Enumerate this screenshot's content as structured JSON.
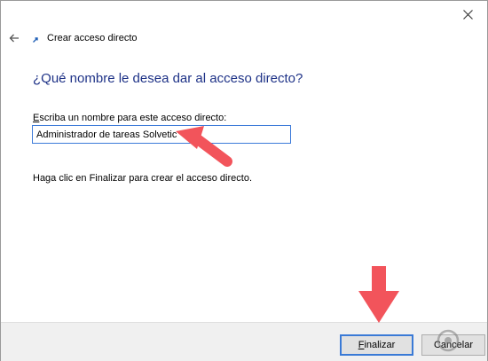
{
  "wizard": {
    "title": "Crear acceso directo",
    "heading": "¿Qué nombre le desea dar al acceso directo?",
    "field_label": "Escriba un nombre para este acceso directo:",
    "name_value": "Administrador de tareas Solvetic",
    "hint": "Haga clic en Finalizar para crear el acceso directo."
  },
  "buttons": {
    "finish_label": "Finalizar",
    "cancel_label": "Cancelar"
  },
  "icons": {
    "back": "back-arrow-icon",
    "wizard": "shortcut-wizard-icon",
    "close": "close-icon",
    "watermark": "solvetic-logo"
  },
  "colors": {
    "heading": "#1e3287",
    "input_border": "#3d7bd9",
    "arrow": "#f2545b",
    "footer": "#f0f0f0"
  }
}
